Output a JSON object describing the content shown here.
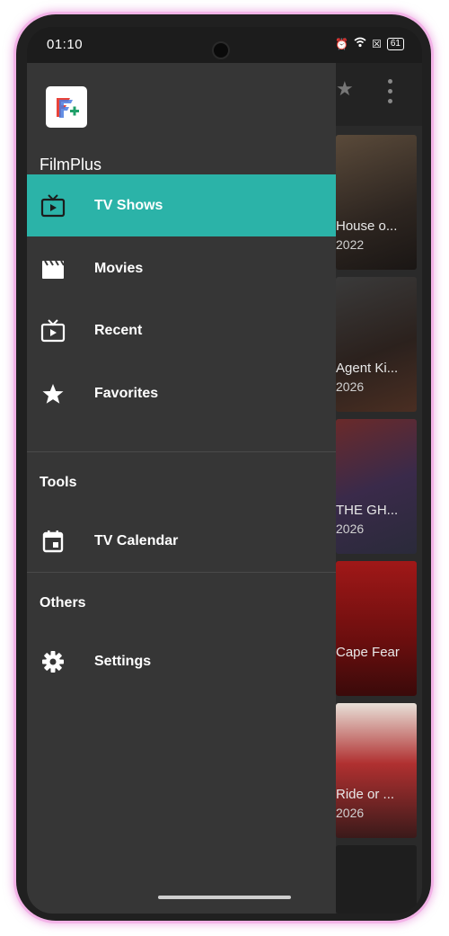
{
  "status": {
    "time": "01:10",
    "battery": "61"
  },
  "drawer": {
    "app_name": "FilmPlus",
    "items": [
      {
        "label": "TV Shows",
        "icon": "tv-icon",
        "active": true
      },
      {
        "label": "Movies",
        "icon": "clapperboard-icon"
      },
      {
        "label": "Recent",
        "icon": "tv-play-icon"
      },
      {
        "label": "Favorites",
        "icon": "star-icon"
      }
    ],
    "sections": {
      "tools": {
        "title": "Tools",
        "items": [
          {
            "label": "TV Calendar",
            "icon": "calendar-icon"
          }
        ]
      },
      "others": {
        "title": "Others",
        "items": [
          {
            "label": "Settings",
            "icon": "gear-icon"
          }
        ]
      }
    }
  },
  "background": {
    "posters": [
      {
        "title": "House o...",
        "year": "2022"
      },
      {
        "title": "Agent Ki...",
        "year": "2026"
      },
      {
        "title": "THE GH...",
        "year": "2026"
      },
      {
        "title": "Cape Fear",
        "year": ""
      },
      {
        "title": "Ride or ...",
        "year": "2026"
      }
    ]
  },
  "colors": {
    "accent": "#2bb3a8",
    "drawer_bg": "#363636"
  }
}
